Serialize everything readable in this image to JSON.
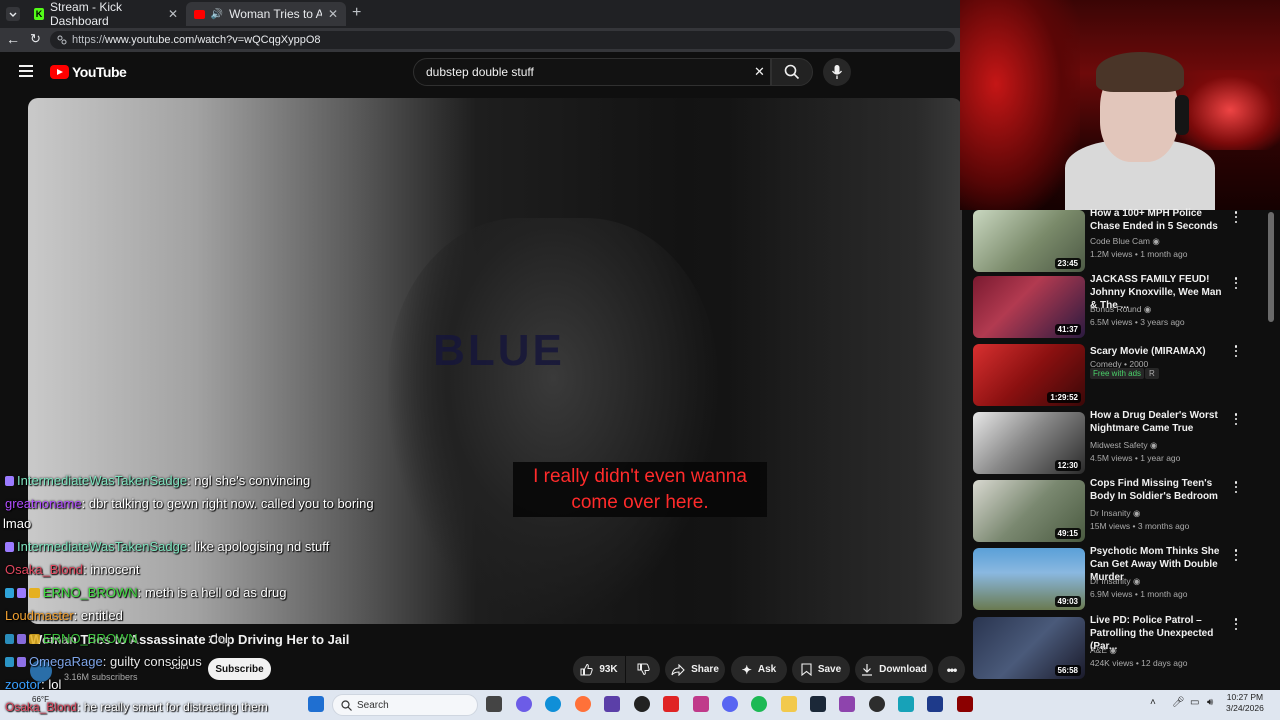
{
  "browser": {
    "tabs": [
      {
        "label": "Stream - Kick Dashboard"
      },
      {
        "label": "Woman Tries to Assassinate C"
      }
    ],
    "url_prefix": "https://",
    "url_main": "www.youtube.com/watch?v=wQCqgXyppO8"
  },
  "youtube": {
    "logo": "YouTube",
    "search_query": "dubstep double stuff"
  },
  "video": {
    "watermark": "BLUE",
    "caption_line1": "I really didn't even wanna",
    "caption_line2": "come over here.",
    "title": "Woman Tries to Assassinate Cop Driving Her to Jail",
    "subscribers": "3.16M subscribers",
    "join": "Join",
    "subscribe": "Subscribe",
    "likes": "93K",
    "share": "Share",
    "ask": "Ask",
    "save": "Save",
    "download": "Download"
  },
  "chat": [
    {
      "user": "IntermediateWasTakenSadge",
      "msg": ": ngl she's convincing",
      "color": "#7fe5c0"
    },
    {
      "user": "greatnoname",
      "msg": ": dbr talking to gewn right now. called you to boring",
      "color": "#b14dff"
    },
    {
      "user": "",
      "msg": "lmao",
      "color": "#ffffff"
    },
    {
      "user": "IntermediateWasTakenSadge",
      "msg": ": like apologising nd stuff",
      "color": "#7fe5c0"
    },
    {
      "user": "Osaka_Blond",
      "msg": ": innocent",
      "color": "#e0475e"
    },
    {
      "user": "ERNO_BROWN",
      "msg": ": meth is a hell od as drug",
      "color": "#43e043"
    },
    {
      "user": "Loudmaster",
      "msg": ": entitled",
      "color": "#f0a030"
    },
    {
      "user": "ERNO_BROWN",
      "msg": ": lol",
      "color": "#43e043"
    },
    {
      "user": "OmegaRage",
      "msg": ": guilty conscious",
      "color": "#8ab4ff"
    },
    {
      "user": "zootor",
      "msg": ": lol",
      "color": "#3aa0ff"
    },
    {
      "user": "Osaka_Blond",
      "msg": ": he really smart for distracting them",
      "color": "#e0475e"
    }
  ],
  "sidebar": [
    {
      "title": "How a 100+ MPH Police Chase Ended in 5 Seconds",
      "channel": "Code Blue Cam",
      "meta": "1.2M views • 1 month ago",
      "duration": "23:45",
      "verified": true
    },
    {
      "title": "JACKASS FAMILY FEUD! Johnny Knoxville, Wee Man & The ...",
      "channel": "Bonus Round",
      "meta": "6.5M views • 3 years ago",
      "duration": "41:37",
      "verified": true
    },
    {
      "title": "Scary Movie (MIRAMAX)",
      "channel": "Comedy • 2000",
      "meta": "",
      "duration": "1:29:52",
      "verified": false,
      "free": "Free with ads",
      "rating": "R"
    },
    {
      "title": "How a Drug Dealer's Worst Nightmare Came True",
      "channel": "Midwest Safety",
      "meta": "4.5M views • 1 year ago",
      "duration": "12:30",
      "verified": true
    },
    {
      "title": "Cops Find Missing Teen's Body In Soldier's Bedroom",
      "channel": "Dr Insanity",
      "meta": "15M views • 3 months ago",
      "duration": "49:15",
      "verified": true
    },
    {
      "title": "Psychotic Mom Thinks She Can Get Away With Double Murder",
      "channel": "Dr Insanity",
      "meta": "6.9M views • 1 month ago",
      "duration": "49:03",
      "verified": true
    },
    {
      "title": "Live PD: Police Patrol – Patrolling the Unexpected (Par...",
      "channel": "A&E",
      "meta": "424K views • 12 days ago",
      "duration": "56:58",
      "verified": true
    }
  ],
  "taskbar": {
    "weather": "66°F",
    "search": "Search",
    "time": "10:27 PM",
    "date": "3/24/2026"
  },
  "colors": {
    "yt_red": "#ff0000",
    "bg": "#0f0f0f",
    "caption_text": "#ff2b2b"
  }
}
